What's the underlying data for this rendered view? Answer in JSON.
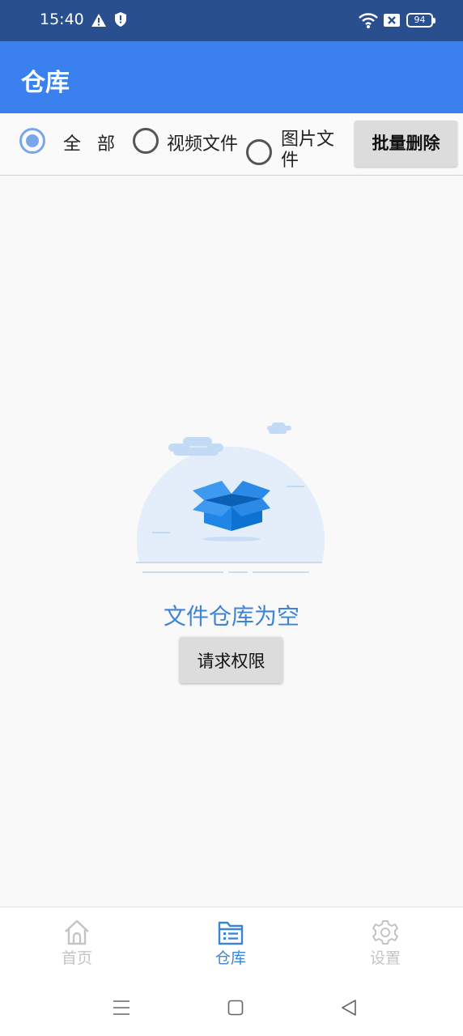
{
  "status_bar": {
    "time": "15:40",
    "battery": "94",
    "icons": [
      "warning-icon",
      "shield-icon",
      "wifi-icon",
      "sim-icon",
      "battery-icon"
    ]
  },
  "app_bar": {
    "title": "仓库"
  },
  "filters": {
    "options": [
      {
        "label": "全部",
        "checked": true
      },
      {
        "label": "视频文件",
        "checked": false
      },
      {
        "label": "图片文件",
        "checked": false
      }
    ],
    "batch_delete_label": "批量删除"
  },
  "empty_state": {
    "message": "文件仓库为空",
    "button_label": "请求权限",
    "illustration": "empty-box-icon"
  },
  "bottom_nav": {
    "items": [
      {
        "label": "首页",
        "icon": "home-icon",
        "active": false
      },
      {
        "label": "仓库",
        "icon": "storage-icon",
        "active": true
      },
      {
        "label": "设置",
        "icon": "gear-icon",
        "active": false
      }
    ]
  },
  "colors": {
    "status_bar": "#2a4f8f",
    "app_bar": "#3a80ee",
    "accent": "#3e84d6",
    "inactive": "#c4c4c4"
  }
}
